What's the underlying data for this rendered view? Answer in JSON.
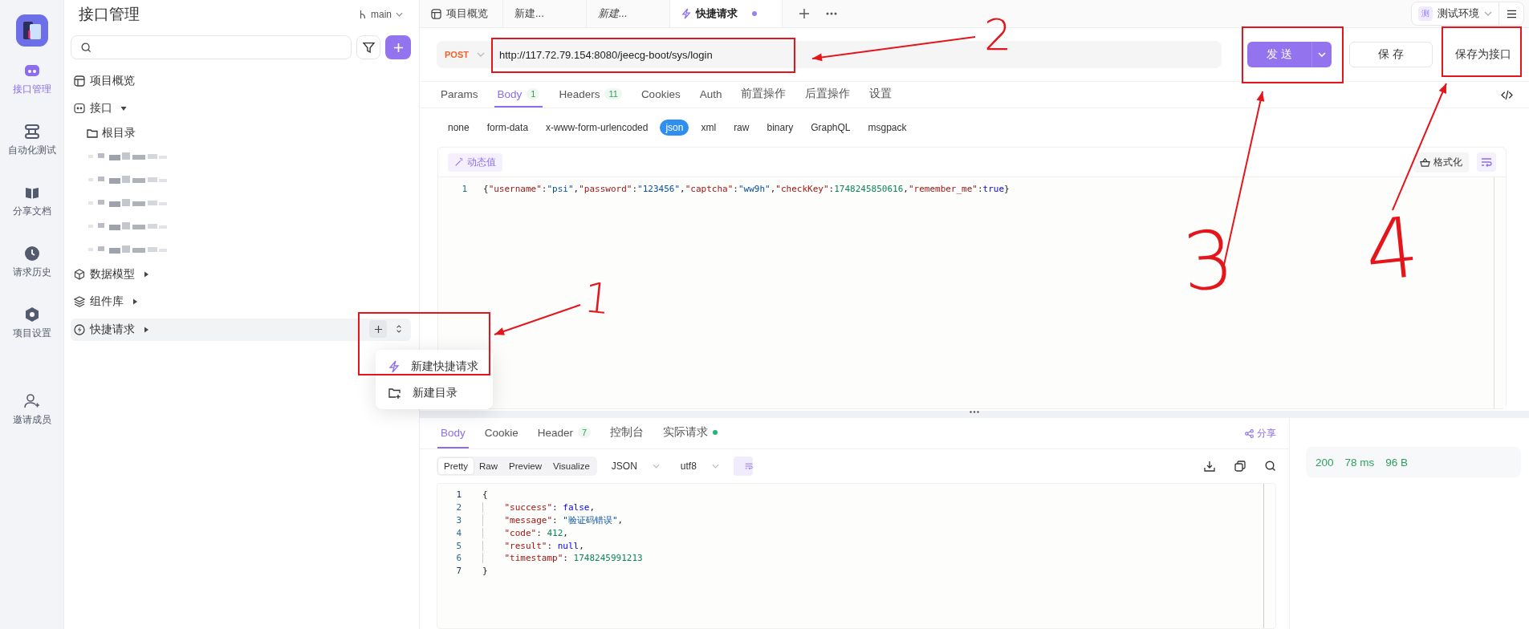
{
  "rail": {
    "items": [
      {
        "label": "接口管理",
        "selected": true
      },
      {
        "label": "自动化测试",
        "selected": false
      },
      {
        "label": "分享文档",
        "selected": false
      },
      {
        "label": "请求历史",
        "selected": false
      },
      {
        "label": "项目设置",
        "selected": false
      }
    ],
    "invite": "邀请成员"
  },
  "tree": {
    "title": "接口管理",
    "branch": "main",
    "items": [
      {
        "label": "项目概览",
        "highlighted": false
      },
      {
        "label": "接口",
        "expanded": true,
        "highlighted": false,
        "children": [
          {
            "kind": "folder",
            "label": "根目录"
          },
          {
            "kind": "redacted"
          },
          {
            "kind": "redacted"
          },
          {
            "kind": "redacted"
          },
          {
            "kind": "redacted"
          },
          {
            "kind": "redacted"
          }
        ]
      },
      {
        "label": "数据模型",
        "expanded": false,
        "highlighted": false
      },
      {
        "label": "组件库",
        "expanded": false,
        "highlighted": false
      },
      {
        "label": "快捷请求",
        "expanded": false,
        "highlighted": true
      }
    ],
    "menu": [
      {
        "label": "新建快捷请求"
      },
      {
        "label": "新建目录"
      }
    ]
  },
  "tabs": [
    {
      "label": "项目概览",
      "selected": false,
      "preview": false,
      "unsaved": false
    },
    {
      "label": "新建...",
      "selected": false,
      "preview": false,
      "unsaved": false
    },
    {
      "label": "新建...",
      "selected": false,
      "preview": true,
      "unsaved": false
    },
    {
      "label": "快捷请求",
      "selected": true,
      "preview": false,
      "unsaved": true
    }
  ],
  "env": {
    "badge": "测",
    "name": "测试环境"
  },
  "request": {
    "method": "POST",
    "url": "http://117.72.79.154:8080/jeecg-boot/sys/login",
    "send": "发 送",
    "save": "保 存",
    "save_as": "保存为接口",
    "tabs": [
      {
        "label": "Params",
        "selected": false
      },
      {
        "label": "Body",
        "count": "1",
        "selected": true
      },
      {
        "label": "Headers",
        "count": "11",
        "selected": false
      },
      {
        "label": "Cookies",
        "selected": false
      },
      {
        "label": "Auth",
        "selected": false
      },
      {
        "label": "前置操作",
        "selected": false
      },
      {
        "label": "后置操作",
        "selected": false
      },
      {
        "label": "设置",
        "selected": false
      }
    ],
    "body_types": [
      {
        "label": "none",
        "selected": false
      },
      {
        "label": "form-data",
        "selected": false
      },
      {
        "label": "x-www-form-urlencoded",
        "selected": false
      },
      {
        "label": "json",
        "selected": true
      },
      {
        "label": "xml",
        "selected": false
      },
      {
        "label": "raw",
        "selected": false
      },
      {
        "label": "binary",
        "selected": false
      },
      {
        "label": "GraphQL",
        "selected": false
      },
      {
        "label": "msgpack",
        "selected": false
      }
    ],
    "dynamic_value": "动态值",
    "format": "格式化",
    "code": [
      {
        "n": "1",
        "tokens": [
          {
            "kind": "punct",
            "text": "{"
          },
          {
            "kind": "key",
            "text": "\"username\""
          },
          {
            "kind": "punct",
            "text": ":"
          },
          {
            "kind": "string",
            "text": "\"psi\""
          },
          {
            "kind": "punct",
            "text": ","
          },
          {
            "kind": "key",
            "text": "\"password\""
          },
          {
            "kind": "punct",
            "text": ":"
          },
          {
            "kind": "string",
            "text": "\"123456\""
          },
          {
            "kind": "punct",
            "text": ","
          },
          {
            "kind": "key",
            "text": "\"captcha\""
          },
          {
            "kind": "punct",
            "text": ":"
          },
          {
            "kind": "string",
            "text": "\"ww9h\""
          },
          {
            "kind": "punct",
            "text": ","
          },
          {
            "kind": "key",
            "text": "\"checkKey\""
          },
          {
            "kind": "punct",
            "text": ":"
          },
          {
            "kind": "number",
            "text": "1748245850616"
          },
          {
            "kind": "punct",
            "text": ","
          },
          {
            "kind": "key",
            "text": "\"remember_me\""
          },
          {
            "kind": "punct",
            "text": ":"
          },
          {
            "kind": "literal",
            "text": "true"
          },
          {
            "kind": "punct",
            "text": "}"
          }
        ]
      }
    ]
  },
  "response": {
    "tabs": [
      {
        "label": "Body",
        "selected": true,
        "dot": false
      },
      {
        "label": "Cookie",
        "selected": false,
        "dot": false
      },
      {
        "label": "Header",
        "count": "7",
        "selected": false,
        "dot": false
      },
      {
        "label": "控制台",
        "selected": false,
        "dot": false
      },
      {
        "label": "实际请求",
        "selected": false,
        "dot": true
      }
    ],
    "share": "分享",
    "views": [
      {
        "label": "Pretty",
        "selected": true
      },
      {
        "label": "Raw",
        "selected": false
      },
      {
        "label": "Preview",
        "selected": false
      },
      {
        "label": "Visualize",
        "selected": false
      }
    ],
    "format": "JSON",
    "encoding": "utf8",
    "code": [
      {
        "n": "1",
        "tokens": [
          {
            "kind": "punct",
            "text": "{"
          }
        ]
      },
      {
        "n": "2",
        "tokens": [
          {
            "kind": "key",
            "text": "    \"success\""
          },
          {
            "kind": "punct",
            "text": ": "
          },
          {
            "kind": "literal",
            "text": "false"
          },
          {
            "kind": "punct",
            "text": ","
          }
        ]
      },
      {
        "n": "3",
        "tokens": [
          {
            "kind": "key",
            "text": "    \"message\""
          },
          {
            "kind": "punct",
            "text": ": "
          },
          {
            "kind": "string",
            "text": "\"验证码错误\""
          },
          {
            "kind": "punct",
            "text": ","
          }
        ]
      },
      {
        "n": "4",
        "tokens": [
          {
            "kind": "key",
            "text": "    \"code\""
          },
          {
            "kind": "punct",
            "text": ": "
          },
          {
            "kind": "number",
            "text": "412"
          },
          {
            "kind": "punct",
            "text": ","
          }
        ]
      },
      {
        "n": "5",
        "tokens": [
          {
            "kind": "key",
            "text": "    \"result\""
          },
          {
            "kind": "punct",
            "text": ": "
          },
          {
            "kind": "literal",
            "text": "null"
          },
          {
            "kind": "punct",
            "text": ","
          }
        ]
      },
      {
        "n": "6",
        "tokens": [
          {
            "kind": "key",
            "text": "    \"timestamp\""
          },
          {
            "kind": "punct",
            "text": ": "
          },
          {
            "kind": "number",
            "text": "1748245991213"
          }
        ]
      },
      {
        "n": "7",
        "tokens": [
          {
            "kind": "punct",
            "text": "}"
          }
        ]
      }
    ],
    "status": {
      "code": "200",
      "time": "78 ms",
      "size": "96 B"
    }
  },
  "annotations": [
    {
      "label": "1"
    },
    {
      "label": "2"
    },
    {
      "label": "3"
    },
    {
      "label": "4"
    }
  ]
}
